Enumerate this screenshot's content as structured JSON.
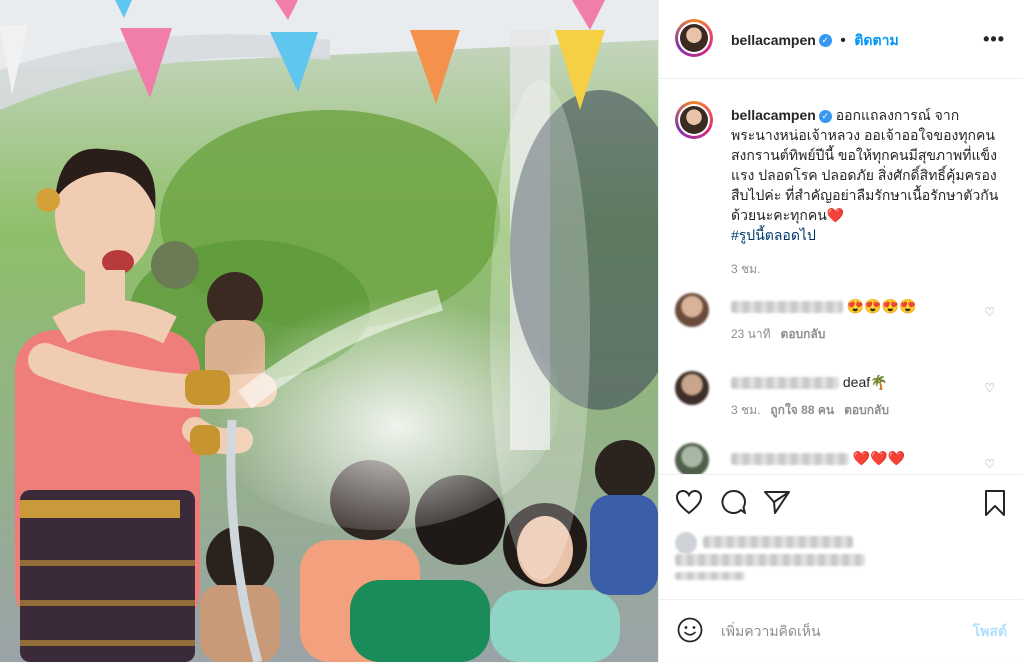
{
  "header": {
    "username": "bellacampen",
    "follow_label": "ติดตาม",
    "more_icon": "more-dots-icon"
  },
  "caption": {
    "username": "bellacampen",
    "text": "ออกแถลงการณ์ จากพระนางหน่อเจ้าหลวง ออเจ้าออใจของทุกคน สงกรานต์ทิพย์ปีนี้ ขอให้ทุกคนมีสุขภาพที่แข็งแรง ปลอดโรค ปลอดภัย สิ่งศักดิ์สิทธิ์คุ้มครองสืบไปค่ะ ที่สำคัญอย่าลืมรักษาเนื้อรักษาตัวกันด้วยนะคะทุกคน",
    "heart": "❤️",
    "hashtag": "#รูปนี้ตลอดไป",
    "time": "3 ชม."
  },
  "comments": [
    {
      "text_suffix": "😍😍😍😍",
      "time": "23 นาที",
      "likes": "",
      "reply": "ตอบกลับ"
    },
    {
      "text_suffix": "deaf🌴",
      "time": "3 ชม.",
      "likes": "ถูกใจ 88 คน",
      "reply": "ตอบกลับ"
    },
    {
      "text_suffix": "❤️❤️❤️",
      "time": "",
      "likes": "",
      "reply": ""
    }
  ],
  "actions": {
    "like_icon": "heart-outline-icon",
    "comment_icon": "comment-icon",
    "share_icon": "send-icon",
    "save_icon": "bookmark-icon"
  },
  "add_comment": {
    "placeholder": "เพิ่มความคิดเห็น",
    "post_label": "โพสต์",
    "emoji_icon": "smiley-icon"
  }
}
